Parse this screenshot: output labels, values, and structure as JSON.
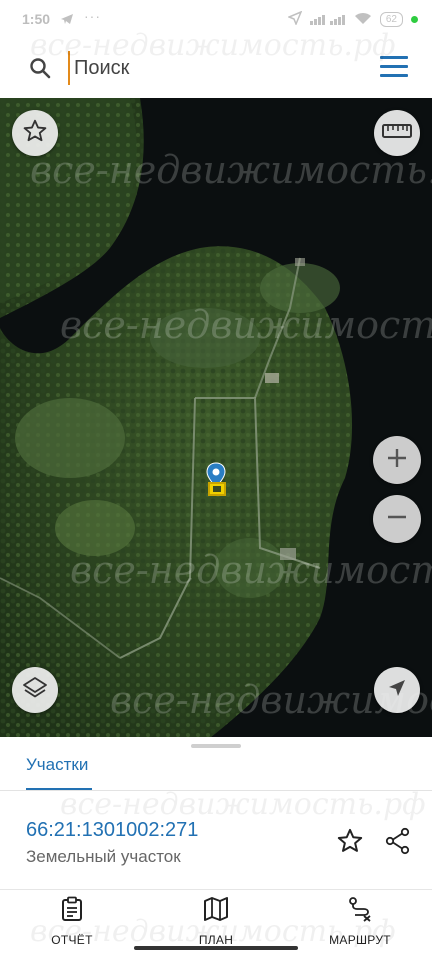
{
  "status": {
    "time": "1:50",
    "battery": "62"
  },
  "search": {
    "placeholder": "Поиск",
    "value": ""
  },
  "watermark": "все-недвижимость.рф",
  "sheet": {
    "tab": "Участки",
    "parcel": {
      "number": "66:21:1301002:271",
      "type": "Земельный участок"
    }
  },
  "nav": [
    {
      "label": "ОТЧЁТ",
      "icon": "report-icon"
    },
    {
      "label": "ПЛАН",
      "icon": "map-icon"
    },
    {
      "label": "МАРШРУТ",
      "icon": "route-icon"
    }
  ],
  "colors": {
    "accent": "#2271b3",
    "marker": "#f0d000",
    "pin": "#2a7ec4",
    "water": "#0b0f10"
  }
}
